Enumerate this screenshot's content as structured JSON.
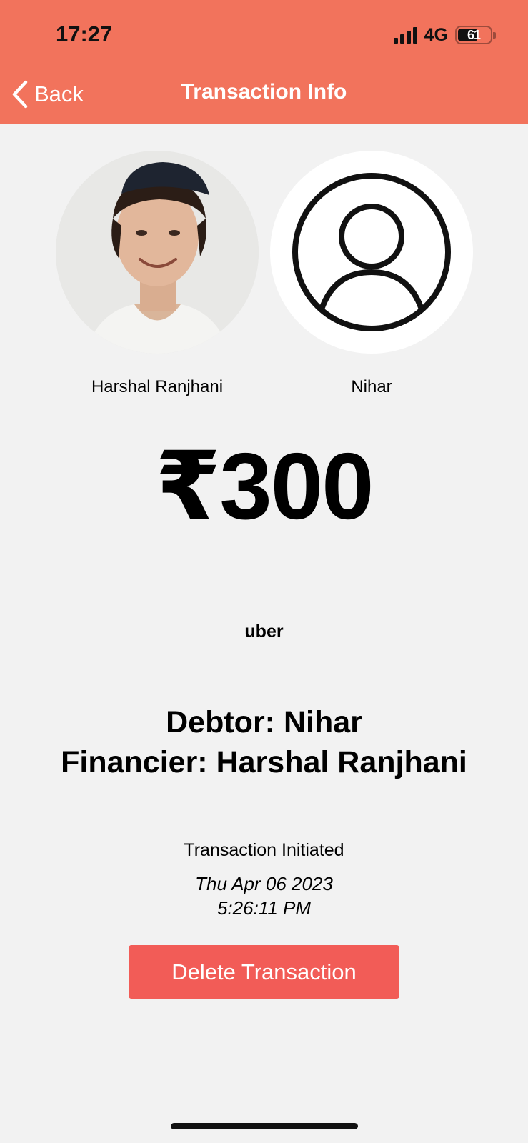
{
  "status_bar": {
    "time": "17:27",
    "network": "4G",
    "battery": "61"
  },
  "header": {
    "back_label": "Back",
    "title": "Transaction Info"
  },
  "parties": {
    "left": {
      "name": "Harshal Ranjhani",
      "avatar": "user-photo"
    },
    "right": {
      "name": "Nihar",
      "avatar": "default-user-icon"
    }
  },
  "transaction": {
    "amount": "₹300",
    "description": "uber",
    "debtor_line": "Debtor: Nihar",
    "financier_line": "Financier: Harshal Ranjhani",
    "initiated_label": "Transaction Initiated",
    "date": "Thu Apr 06 2023",
    "time": "5:26:11 PM"
  },
  "actions": {
    "delete_label": "Delete Transaction"
  },
  "colors": {
    "header": "#f2735c",
    "delete_button": "#f25c57",
    "background": "#f2f2f2"
  }
}
